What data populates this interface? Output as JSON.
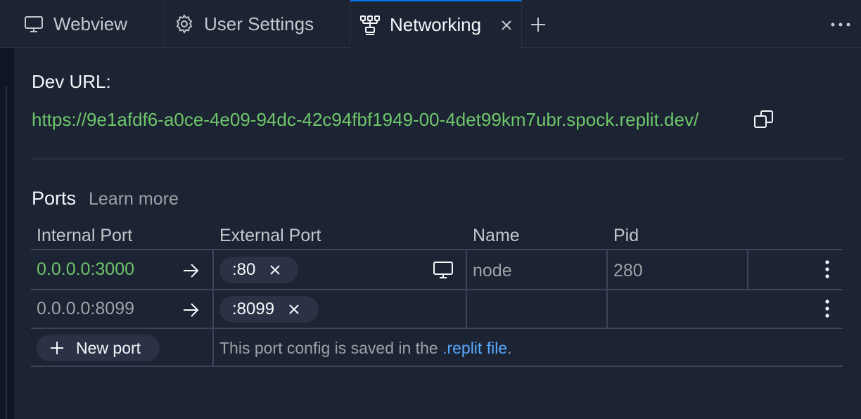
{
  "tabs": [
    {
      "label": "Webview",
      "icon": "monitor-icon"
    },
    {
      "label": "User Settings",
      "icon": "gear-icon"
    },
    {
      "label": "Networking",
      "icon": "network-icon"
    }
  ],
  "dev": {
    "label": "Dev URL:",
    "url": "https://9e1afdf6-a0ce-4e09-94dc-42c94fbf1949-00-4det99km7ubr.spock.replit.dev/"
  },
  "ports": {
    "title": "Ports",
    "learn_more": "Learn more",
    "headers": {
      "internal": "Internal Port",
      "external": "External Port",
      "name": "Name",
      "pid": "Pid"
    },
    "rows": [
      {
        "internal": "0.0.0.0:3000",
        "external": ":80",
        "name": "node",
        "pid": "280",
        "active": true
      },
      {
        "internal": "0.0.0.0:8099",
        "external": ":8099",
        "name": "",
        "pid": "",
        "active": false
      }
    ],
    "new_port_label": "New port",
    "note_prefix": "This port config is saved in the ",
    "note_link": ".replit file",
    "note_suffix": "."
  },
  "colors": {
    "background": "#1c2333",
    "url_green": "#6ec66a",
    "link_blue": "#57abff",
    "active_tab_accent": "#0079f2"
  }
}
